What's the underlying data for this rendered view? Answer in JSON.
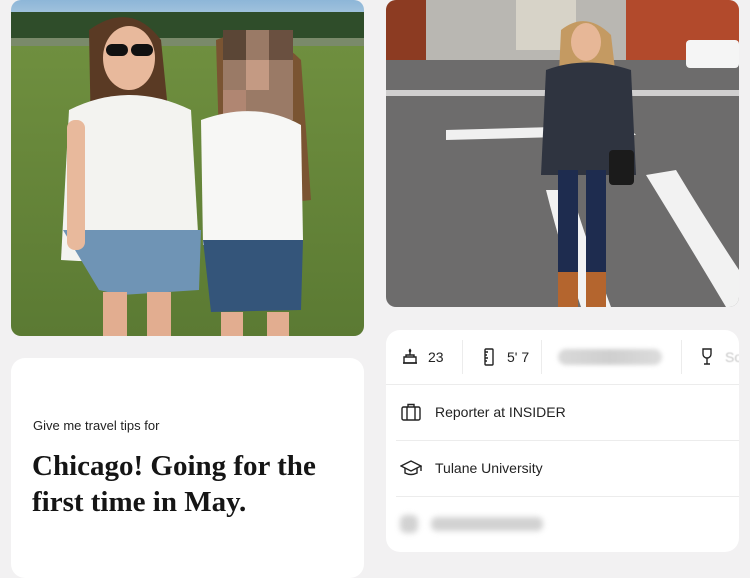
{
  "photos": {
    "left": {
      "alt_name": "profile-photo-1"
    },
    "right": {
      "alt_name": "profile-photo-2"
    }
  },
  "prompt": {
    "label": "Give me travel tips for",
    "answer": "Chicago! Going for the first time in May."
  },
  "vitals": {
    "age": "23",
    "height": "5' 7",
    "drink_partial": "So"
  },
  "details": {
    "job": "Reporter at INSIDER",
    "school": "Tulane University"
  },
  "icons": {
    "age": "cake-icon",
    "height": "ruler-icon",
    "blurred": "blurred-icon",
    "drinks": "wine-glass-icon",
    "job": "briefcase-icon",
    "school": "graduation-cap-icon"
  }
}
